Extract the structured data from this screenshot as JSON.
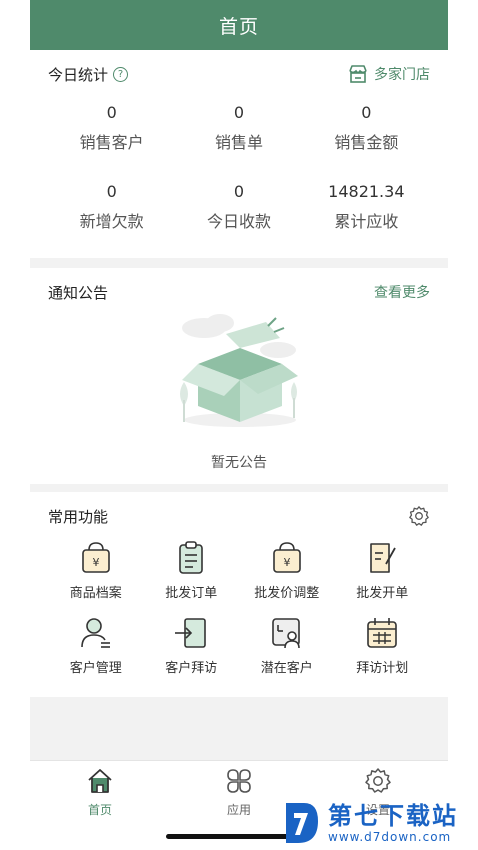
{
  "header": {
    "title": "首页"
  },
  "stats": {
    "title": "今日统计",
    "help_icon": "help-circle-icon",
    "store_link": "多家门店",
    "store_icon": "store-icon",
    "items": [
      {
        "value": "0",
        "label": "销售客户"
      },
      {
        "value": "0",
        "label": "销售单"
      },
      {
        "value": "0",
        "label": "销售金额"
      },
      {
        "value": "0",
        "label": "新增欠款"
      },
      {
        "value": "0",
        "label": "今日收款"
      },
      {
        "value": "14821.34",
        "label": "累计应收"
      }
    ]
  },
  "notice": {
    "title": "通知公告",
    "more_link": "查看更多",
    "empty_text": "暂无公告"
  },
  "functions": {
    "title": "常用功能",
    "settings_icon": "gear-icon",
    "items": [
      {
        "label": "商品档案",
        "icon": "product-bag-icon"
      },
      {
        "label": "批发订单",
        "icon": "order-clipboard-icon"
      },
      {
        "label": "批发价调整",
        "icon": "price-bag-icon"
      },
      {
        "label": "批发开单",
        "icon": "edit-document-icon"
      },
      {
        "label": "客户管理",
        "icon": "customer-icon"
      },
      {
        "label": "客户拜访",
        "icon": "visit-door-icon"
      },
      {
        "label": "潜在客户",
        "icon": "potential-customer-icon"
      },
      {
        "label": "拜访计划",
        "icon": "calendar-icon"
      }
    ]
  },
  "tabbar": {
    "items": [
      {
        "label": "首页",
        "icon": "home-icon",
        "active": true
      },
      {
        "label": "应用",
        "icon": "apps-grid-icon",
        "active": false
      },
      {
        "label": "设置",
        "icon": "settings-icon",
        "active": false
      }
    ]
  },
  "watermark": {
    "title": "第七下载站",
    "subtitle": "www.d7down.com"
  },
  "colors": {
    "primary": "#4f8a6b",
    "background": "#f2f2f2",
    "watermark": "#1a63c4"
  }
}
